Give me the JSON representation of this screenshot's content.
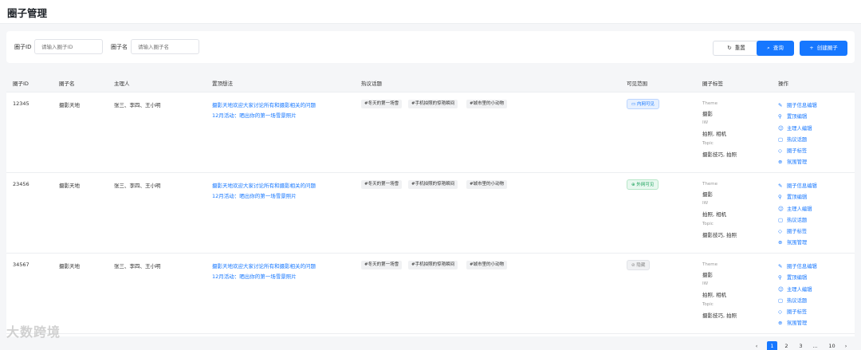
{
  "page": {
    "title": "圈子管理"
  },
  "filter": {
    "circle_id_label": "圈子ID",
    "circle_id_placeholder": "请输入圈子ID",
    "circle_name_label": "圈子名",
    "circle_name_placeholder": "请输入圈子名",
    "reset_label": "重置",
    "query_label": "查询",
    "create_label": "创建圈子"
  },
  "table": {
    "columns": [
      "圈子ID",
      "圈子名",
      "主理人",
      "置顶想法",
      "热议话题",
      "可见范围",
      "圈子标签",
      "操作"
    ],
    "rows": [
      {
        "id": "12345",
        "name": "摄影天地",
        "owners": "张三、李四、王小明",
        "pinned": [
          "摄影天地欢迎大家讨论所有和摄影相关的问题",
          "12月活动：晒出你的第一场雪景照片"
        ],
        "topics": [
          "#冬天的第一场雪",
          "#手机拍照的惊艳瞬间",
          "#城市里的小动物"
        ],
        "visibility": "内网可见",
        "visibility_type": "inner",
        "tags": [
          {
            "key": "Theme",
            "value": "摄影"
          },
          {
            "key": "IW",
            "value": "拍照, 相机"
          },
          {
            "key": "Topic",
            "value": "摄影技巧, 拍照"
          }
        ]
      },
      {
        "id": "23456",
        "name": "摄影天地",
        "owners": "张三、李四、王小明",
        "pinned": [
          "摄影天地欢迎大家讨论所有和摄影相关的问题",
          "12月活动：晒出你的第一场雪景照片"
        ],
        "topics": [
          "#冬天的第一场雪",
          "#手机拍照的惊艳瞬间",
          "#城市里的小动物"
        ],
        "visibility": "外网可见",
        "visibility_type": "outer",
        "tags": [
          {
            "key": "Theme",
            "value": "摄影"
          },
          {
            "key": "IW",
            "value": "拍照, 相机"
          },
          {
            "key": "Topic",
            "value": "摄影技巧, 拍照"
          }
        ]
      },
      {
        "id": "34567",
        "name": "摄影天地",
        "owners": "张三、李四、王小明",
        "pinned": [
          "摄影天地欢迎大家讨论所有和摄影相关的问题",
          "12月活动：晒出你的第一场雪景照片"
        ],
        "topics": [
          "#冬天的第一场雪",
          "#手机拍照的惊艳瞬间",
          "#城市里的小动物"
        ],
        "visibility": "隐藏",
        "visibility_type": "hidden",
        "tags": [
          {
            "key": "Theme",
            "value": "摄影"
          },
          {
            "key": "IW",
            "value": "拍照, 相机"
          },
          {
            "key": "Topic",
            "value": "摄影技巧, 拍照"
          }
        ]
      }
    ],
    "actions": [
      {
        "label": "圈子信息编辑",
        "icon": "edit-icon"
      },
      {
        "label": "置顶编辑",
        "icon": "pin-icon"
      },
      {
        "label": "主理人编辑",
        "icon": "user-icon"
      },
      {
        "label": "热议话题",
        "icon": "chat-icon"
      },
      {
        "label": "圈子标签",
        "icon": "tag-icon"
      },
      {
        "label": "氛围管理",
        "icon": "atmosphere-icon"
      }
    ]
  },
  "pagination": {
    "pages": [
      "1",
      "2",
      "3",
      "...",
      "10"
    ],
    "current": "1",
    "prev": "‹",
    "next": "›"
  },
  "watermark": "大数跨境",
  "colors": {
    "primary": "#1677ff",
    "success": "#18a058",
    "muted": "#888888"
  }
}
